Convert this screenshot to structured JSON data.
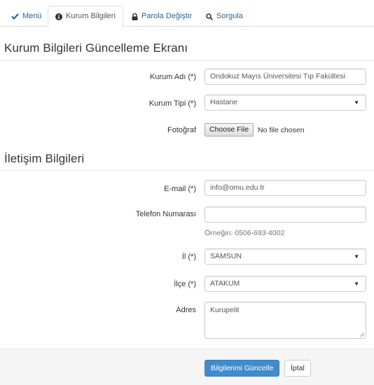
{
  "tabs": [
    {
      "label": "Menü",
      "icon": "check-icon"
    },
    {
      "label": "Kurum Bilgileri",
      "icon": "info-circle-icon"
    },
    {
      "label": "Parola Değiştir",
      "icon": "lock-icon"
    },
    {
      "label": "Sorgula",
      "icon": "search-icon"
    }
  ],
  "colors": {
    "link": "#2a6496",
    "primary": "#428bca",
    "footer_bg": "#f5f5f5"
  },
  "section1": {
    "title": "Kurum Bilgileri Güncelleme Ekranı",
    "kurum_adi": {
      "label": "Kurum Adı (*)",
      "value": "Ondokuz Mayıs Üniversitesi Tıp Fakültesi"
    },
    "kurum_tipi": {
      "label": "Kurum Tipi (*)",
      "value": "Hastane"
    },
    "fotograf": {
      "label": "Fotoğraf",
      "button": "Choose File",
      "status": "No file chosen"
    }
  },
  "section2": {
    "title": "İletişim Bilgileri",
    "email": {
      "label": "E-mail (*)",
      "value": "info@omu.edu.tr"
    },
    "telefon": {
      "label": "Telefon Numarası",
      "value": "",
      "help": "Örneğin: 0506-693-4002"
    },
    "il": {
      "label": "İl (*)",
      "value": "SAMSUN"
    },
    "ilce": {
      "label": "İlçe (*)",
      "value": "ATAKUM"
    },
    "adres": {
      "label": "Adres",
      "value": "Kurupelit"
    }
  },
  "actions": {
    "submit": "Bilgilerimi Güncelle",
    "cancel": "İptal"
  }
}
